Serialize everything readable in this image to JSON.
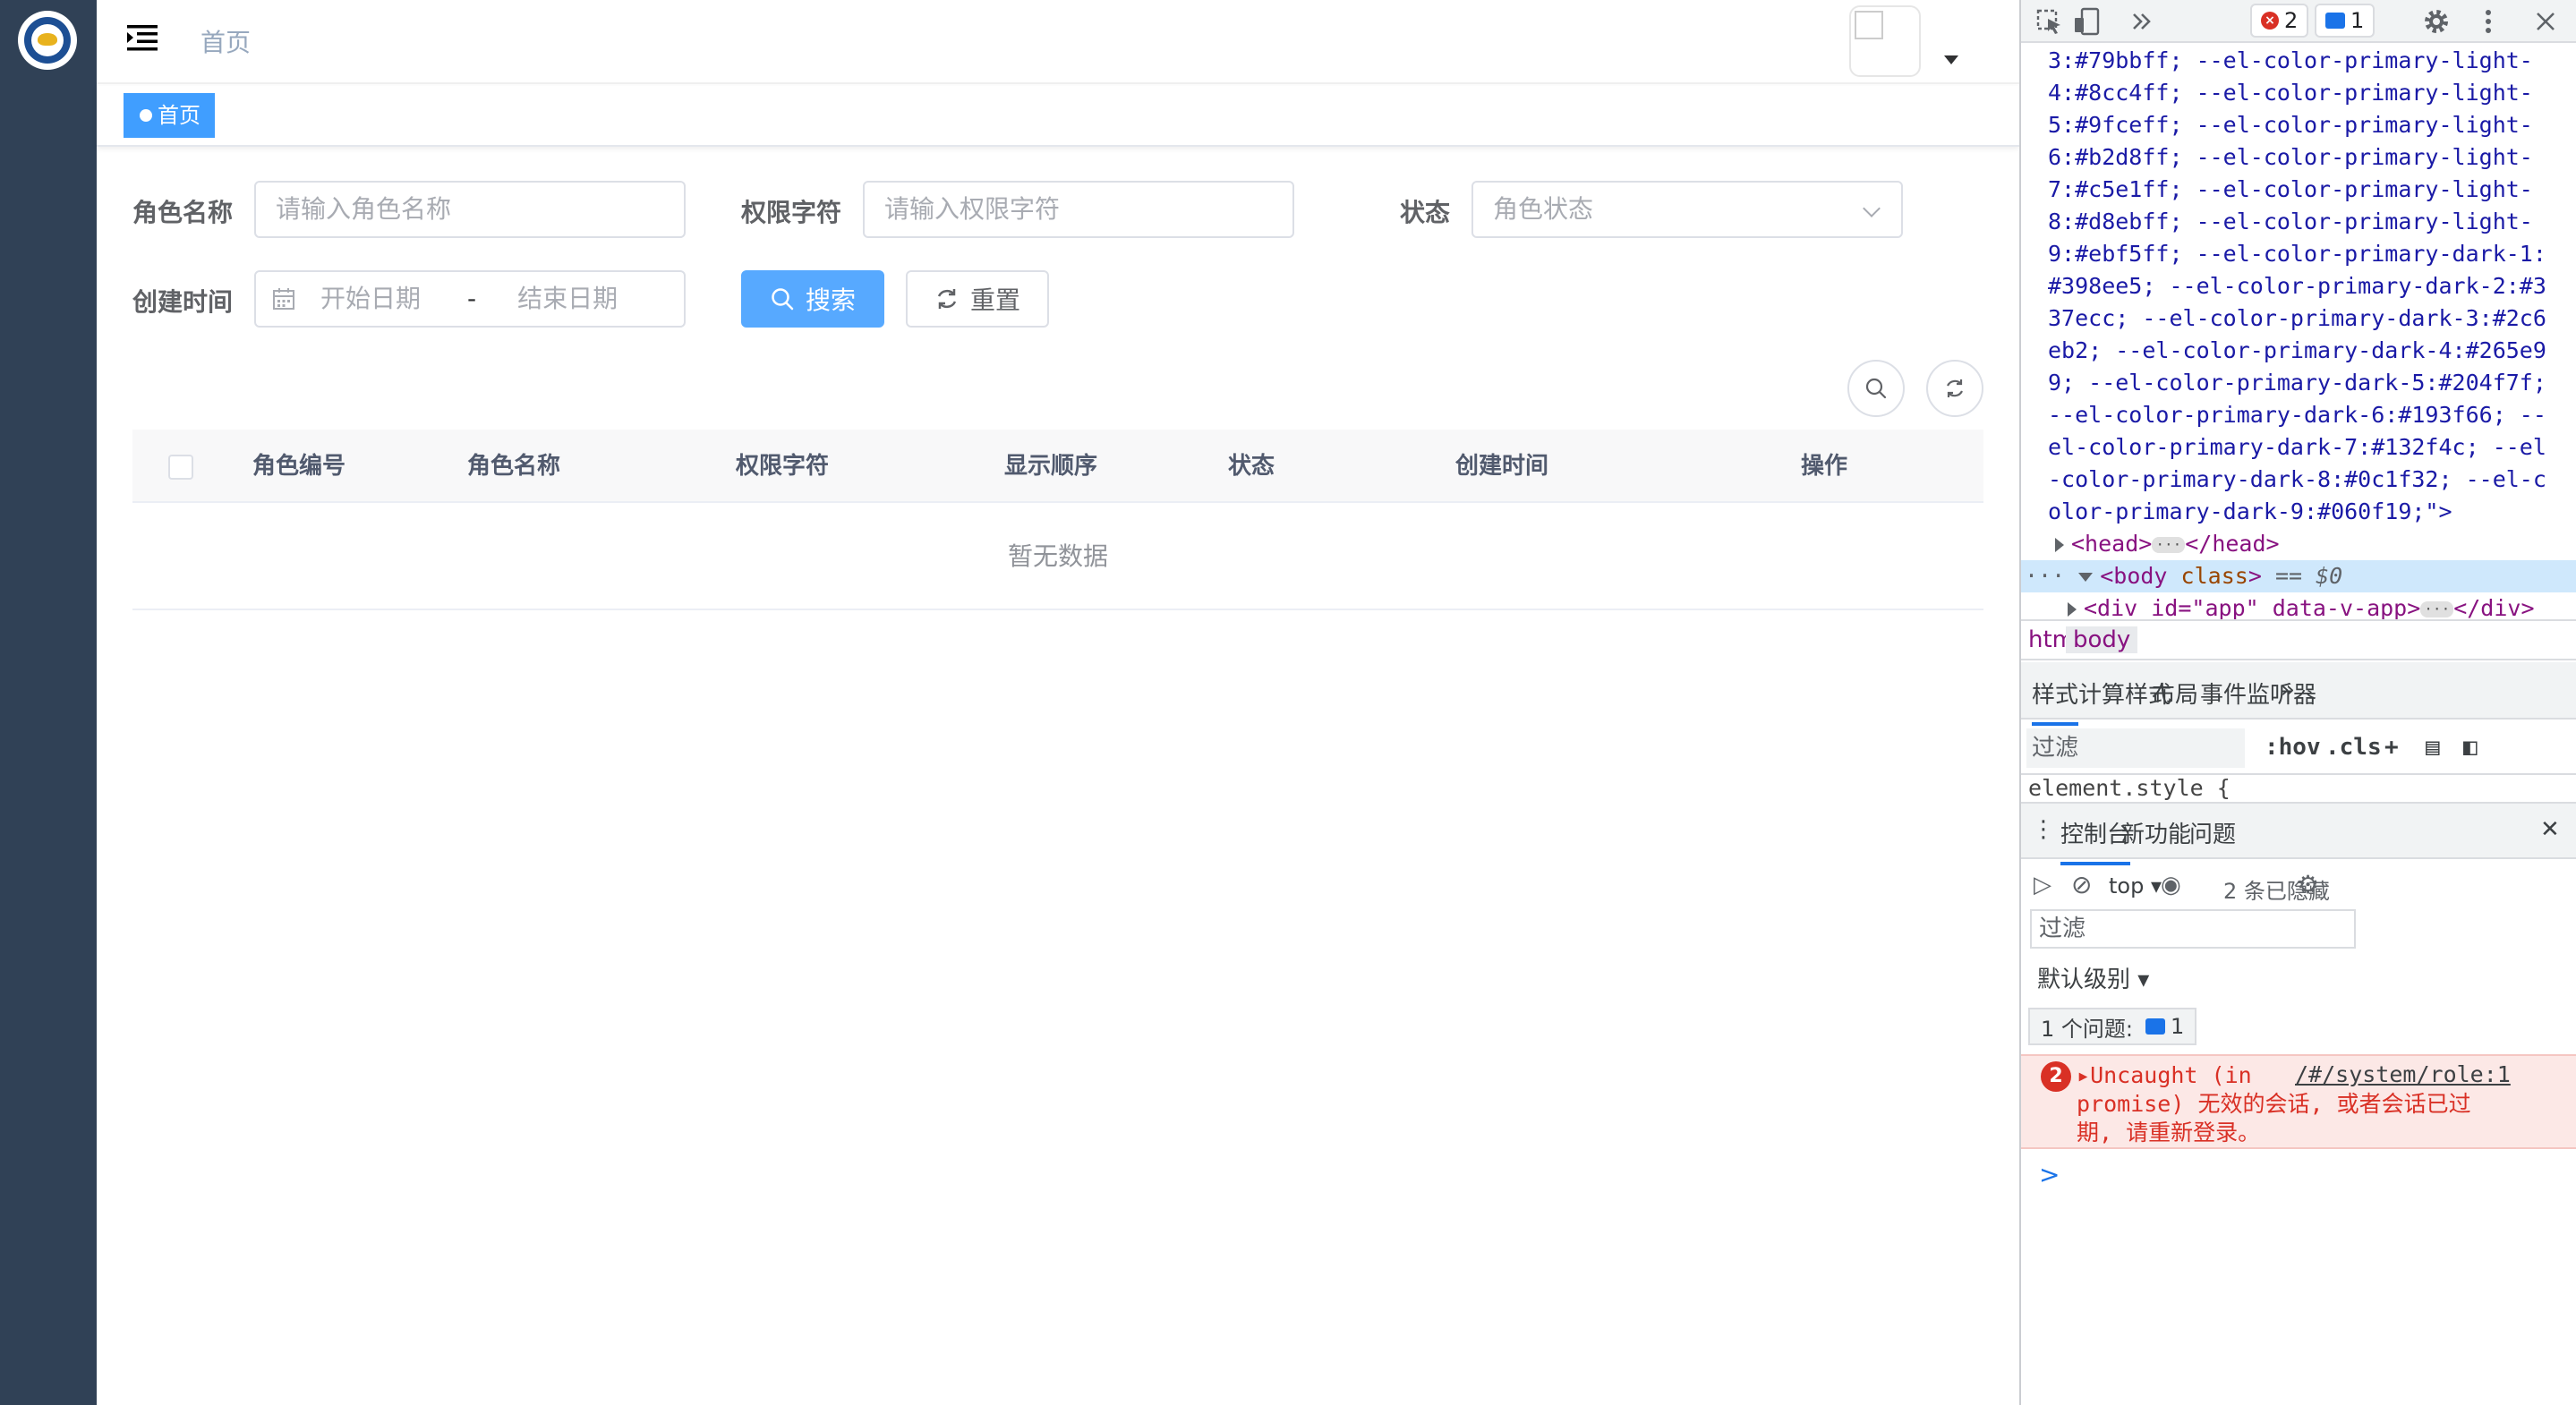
{
  "navbar": {
    "breadcrumb": "首页"
  },
  "tags": {
    "active_tag": "首页"
  },
  "search_form": {
    "role_name_label": "角色名称",
    "role_name_placeholder": "请输入角色名称",
    "role_key_label": "权限字符",
    "role_key_placeholder": "请输入权限字符",
    "status_label": "状态",
    "status_placeholder": "角色状态",
    "create_time_label": "创建时间",
    "start_date_placeholder": "开始日期",
    "range_separator": "-",
    "end_date_placeholder": "结束日期",
    "search_button": "搜索",
    "reset_button": "重置"
  },
  "table": {
    "columns": [
      "角色编号",
      "角色名称",
      "权限字符",
      "显示顺序",
      "状态",
      "创建时间",
      "操作"
    ],
    "empty_text": "暂无数据"
  },
  "devtools": {
    "error_badge_count": "2",
    "message_badge_count": "1",
    "dom_lines": [
      "3:#79bbff; --el-color-primary-light-",
      "4:#8cc4ff; --el-color-primary-light-",
      "5:#9fceff; --el-color-primary-light-",
      "6:#b2d8ff; --el-color-primary-light-",
      "7:#c5e1ff; --el-color-primary-light-",
      "8:#d8ebff; --el-color-primary-light-",
      "9:#ebf5ff; --el-color-primary-dark-1:",
      "#398ee5; --el-color-primary-dark-2:#3",
      "37ecc; --el-color-primary-dark-3:#2c6",
      "eb2; --el-color-primary-dark-4:#265e9",
      "9; --el-color-primary-dark-5:#204f7f;",
      "--el-color-primary-dark-6:#193f66; --",
      "el-color-primary-dark-7:#132f4c; --el",
      "-color-primary-dark-8:#0c1f32; --el-c",
      "olor-primary-dark-9:#060f19;\">"
    ],
    "head_open": "<head>",
    "head_close": "</head>",
    "body_tag": "<body",
    "body_attr": "class",
    "body_eq": "== $0",
    "div_line": "<div id=\"app\" data-v-app>",
    "div_close": "</div>",
    "crumb_html": "html.",
    "crumb_body": "body",
    "styles_tabs": [
      "样式",
      "计算样式",
      "布局",
      "事件监听器"
    ],
    "styles_filter": "过滤",
    "hov": ":hov",
    "cls": ".cls",
    "element_style": "element.style {",
    "console_tabs": [
      "控制台",
      "新功能",
      "问题"
    ],
    "context": "top",
    "hidden_count": "2 条已隐藏",
    "console_filter": "过滤",
    "default_level": "默认级别",
    "issues_label": "1 个问题:",
    "issues_count": "1",
    "error_count": "2",
    "error_line1": "Uncaught (in",
    "error_link": "/#/system/role:1",
    "error_line2": "promise) 无效的会话, 或者会话已过",
    "error_line3": "期, 请重新登录。",
    "prompt": ">"
  },
  "colors": {
    "sidebar": "#304156",
    "primary": "#409eff",
    "error": "#d93025",
    "devtools_blue": "#1a73e8"
  }
}
